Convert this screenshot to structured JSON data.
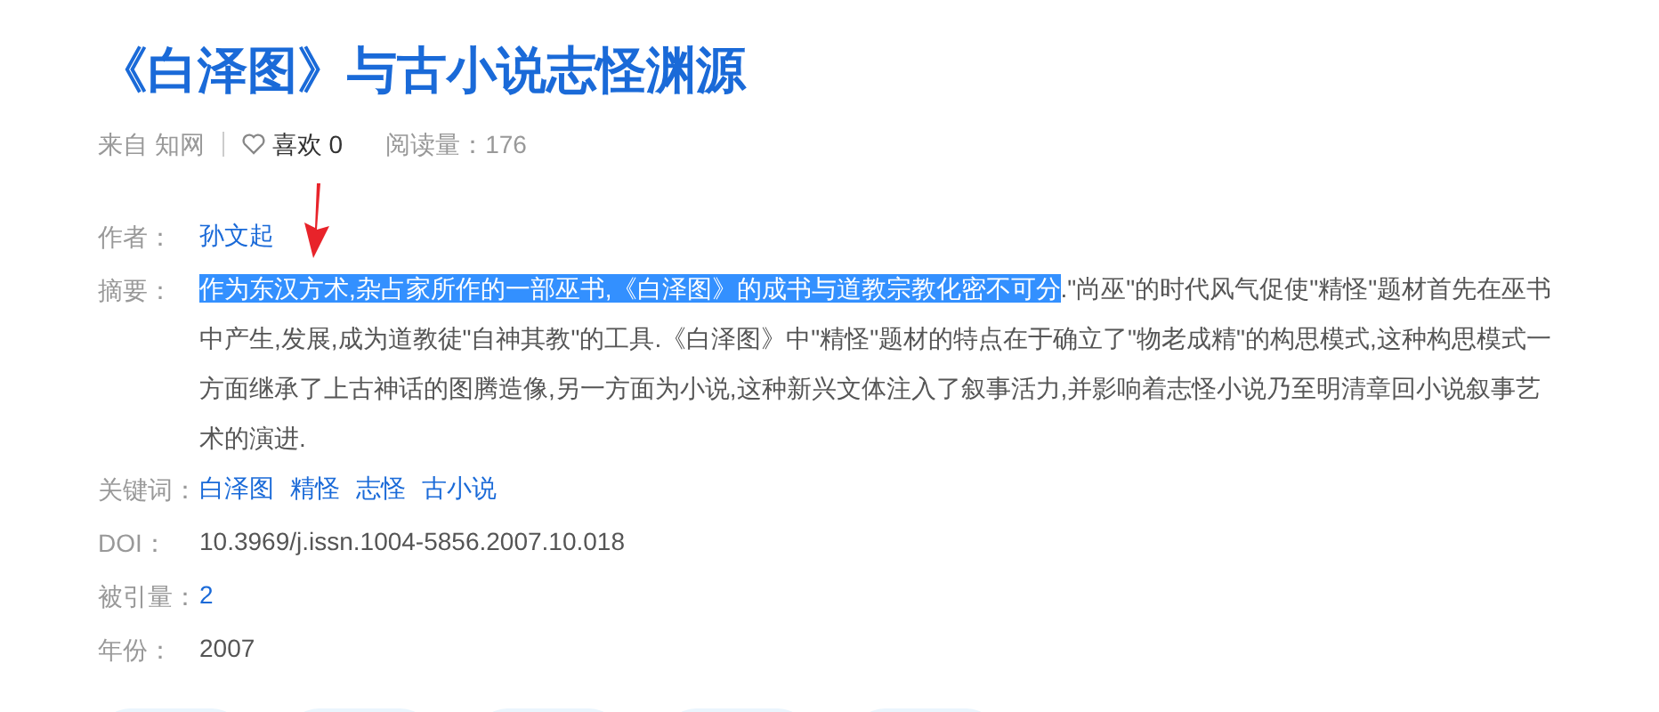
{
  "title": "《白泽图》与古小说志怪渊源",
  "meta": {
    "source": "来自 知网",
    "like_label": "喜欢 0",
    "reads": "阅读量：176"
  },
  "fields": [
    {
      "kind": "link",
      "label": "作者：",
      "values": [
        "孙文起"
      ]
    },
    {
      "kind": "abstract",
      "label": "摘要：",
      "highlighted": "作为东汉方术,杂占家所作的一部巫书,《白泽图》的成书与道教宗教化密不可分",
      "rest": ".\"尚巫\"的时代风气促使\"精怪\"题材首先在巫书中产生,发展,成为道教徒\"自神其教\"的工具.《白泽图》中\"精怪\"题材的特点在于确立了\"物老成精\"的构思模式,这种构思模式一方面继承了上古神话的图腾造像,另一方面为小说,这种新兴文体注入了叙事活力,并影响着志怪小说乃至明清章回小说叙事艺术的演进."
    },
    {
      "kind": "link",
      "label": "关键词：",
      "values": [
        "白泽图",
        "精怪",
        "志怪",
        "古小说"
      ]
    },
    {
      "kind": "text",
      "label": "DOI：",
      "values": [
        "10.3969/j.issn.1004-5856.2007.10.018"
      ]
    },
    {
      "kind": "link",
      "label": "被引量：",
      "values": [
        "2"
      ]
    },
    {
      "kind": "text",
      "label": "年份：",
      "values": [
        "2007"
      ]
    }
  ],
  "action_buttons": [
    {
      "kind": "button"
    },
    {
      "kind": "button"
    },
    {
      "kind": "button"
    },
    {
      "kind": "button"
    },
    {
      "kind": "button"
    }
  ]
}
